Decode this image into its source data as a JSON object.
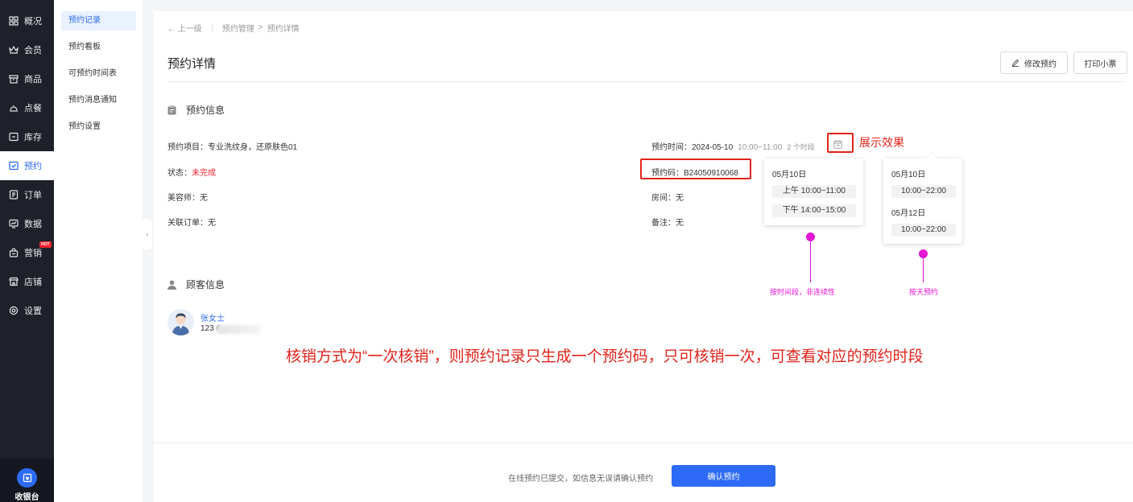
{
  "nav": {
    "items": [
      {
        "label": "概况",
        "icon": "grid-icon"
      },
      {
        "label": "会员",
        "icon": "crown-icon"
      },
      {
        "label": "商品",
        "icon": "store-box-icon"
      },
      {
        "label": "点餐",
        "icon": "cloche-icon"
      },
      {
        "label": "库存",
        "icon": "inventory-icon"
      },
      {
        "label": "预约",
        "icon": "calendar-check-icon"
      },
      {
        "label": "订单",
        "icon": "order-list-icon"
      },
      {
        "label": "数据",
        "icon": "chart-icon"
      },
      {
        "label": "营销",
        "icon": "shop-bag-icon",
        "badge": "HOT"
      },
      {
        "label": "店铺",
        "icon": "shop-icon"
      },
      {
        "label": "设置",
        "icon": "gear-icon"
      }
    ],
    "active": "预约",
    "cashier_label": "收银台"
  },
  "subnav": {
    "items": [
      "预约记录",
      "预约看板",
      "可预约时间表",
      "预约消息通知",
      "预约设置"
    ],
    "active": "预约记录"
  },
  "breadcrumb": {
    "back": "上一级",
    "path1": "预约管理",
    "arrow": ">",
    "path2": "预约详情"
  },
  "page": {
    "title": "预约详情",
    "edit_label": "修改预约",
    "print_label": "打印小票"
  },
  "booking": {
    "section_title": "预约信息",
    "project": "预约项目：专业洗纹身，还原肤色01",
    "status_label": "状态：",
    "status_value": "未完成",
    "beautician": "美容师：无",
    "related_order": "关联订单：无",
    "time_label": "预约时间：2024-05-10",
    "time_range": "10:00~11:00",
    "time_count": "2 个时段",
    "code": "预约码：B24050910068",
    "room": "房间：无",
    "remark": "备注：无"
  },
  "popover1": {
    "date": "05月10日",
    "slots": [
      "上午 10:00~11:00",
      "下午 14:00~15:00"
    ]
  },
  "popover2": {
    "days": [
      {
        "date": "05月10日",
        "slot": "10:00~22:00"
      },
      {
        "date": "05月12日",
        "slot": "10:00~22:00"
      }
    ]
  },
  "annotations": {
    "display_effect": "展示效果",
    "by_time_slot": "按时间段，非连续性",
    "by_day": "按天预约",
    "caption": "核销方式为“一次核销”，则预约记录只生成一个预约码，只可核销一次，可查看对应的预约时段"
  },
  "customer": {
    "section_title": "顾客信息",
    "name": "张女士",
    "phone": "123 6"
  },
  "footer": {
    "note": "在线预约已提交，如信息无误请确认预约",
    "confirm_label": "确认预约"
  },
  "colors": {
    "primary": "#2d6bf6",
    "nav_bg": "#1e2129",
    "annotation_red": "#e0241b",
    "annotation_magenta": "#e516d4",
    "status_red": "#f5222d"
  }
}
